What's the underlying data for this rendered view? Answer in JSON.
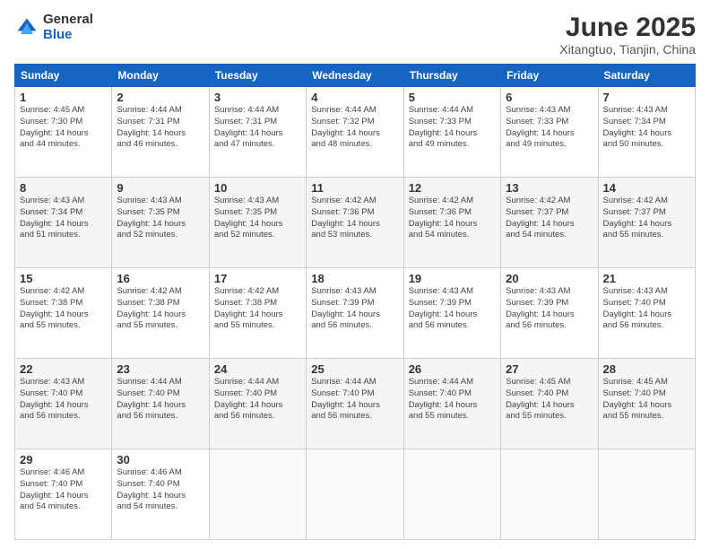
{
  "logo": {
    "general": "General",
    "blue": "Blue"
  },
  "title": "June 2025",
  "subtitle": "Xitangtuo, Tianjin, China",
  "headers": [
    "Sunday",
    "Monday",
    "Tuesday",
    "Wednesday",
    "Thursday",
    "Friday",
    "Saturday"
  ],
  "weeks": [
    [
      {
        "day": "1",
        "lines": [
          "Sunrise: 4:45 AM",
          "Sunset: 7:30 PM",
          "Daylight: 14 hours",
          "and 44 minutes."
        ]
      },
      {
        "day": "2",
        "lines": [
          "Sunrise: 4:44 AM",
          "Sunset: 7:31 PM",
          "Daylight: 14 hours",
          "and 46 minutes."
        ]
      },
      {
        "day": "3",
        "lines": [
          "Sunrise: 4:44 AM",
          "Sunset: 7:31 PM",
          "Daylight: 14 hours",
          "and 47 minutes."
        ]
      },
      {
        "day": "4",
        "lines": [
          "Sunrise: 4:44 AM",
          "Sunset: 7:32 PM",
          "Daylight: 14 hours",
          "and 48 minutes."
        ]
      },
      {
        "day": "5",
        "lines": [
          "Sunrise: 4:44 AM",
          "Sunset: 7:33 PM",
          "Daylight: 14 hours",
          "and 49 minutes."
        ]
      },
      {
        "day": "6",
        "lines": [
          "Sunrise: 4:43 AM",
          "Sunset: 7:33 PM",
          "Daylight: 14 hours",
          "and 49 minutes."
        ]
      },
      {
        "day": "7",
        "lines": [
          "Sunrise: 4:43 AM",
          "Sunset: 7:34 PM",
          "Daylight: 14 hours",
          "and 50 minutes."
        ]
      }
    ],
    [
      {
        "day": "8",
        "lines": [
          "Sunrise: 4:43 AM",
          "Sunset: 7:34 PM",
          "Daylight: 14 hours",
          "and 51 minutes."
        ]
      },
      {
        "day": "9",
        "lines": [
          "Sunrise: 4:43 AM",
          "Sunset: 7:35 PM",
          "Daylight: 14 hours",
          "and 52 minutes."
        ]
      },
      {
        "day": "10",
        "lines": [
          "Sunrise: 4:43 AM",
          "Sunset: 7:35 PM",
          "Daylight: 14 hours",
          "and 52 minutes."
        ]
      },
      {
        "day": "11",
        "lines": [
          "Sunrise: 4:42 AM",
          "Sunset: 7:36 PM",
          "Daylight: 14 hours",
          "and 53 minutes."
        ]
      },
      {
        "day": "12",
        "lines": [
          "Sunrise: 4:42 AM",
          "Sunset: 7:36 PM",
          "Daylight: 14 hours",
          "and 54 minutes."
        ]
      },
      {
        "day": "13",
        "lines": [
          "Sunrise: 4:42 AM",
          "Sunset: 7:37 PM",
          "Daylight: 14 hours",
          "and 54 minutes."
        ]
      },
      {
        "day": "14",
        "lines": [
          "Sunrise: 4:42 AM",
          "Sunset: 7:37 PM",
          "Daylight: 14 hours",
          "and 55 minutes."
        ]
      }
    ],
    [
      {
        "day": "15",
        "lines": [
          "Sunrise: 4:42 AM",
          "Sunset: 7:38 PM",
          "Daylight: 14 hours",
          "and 55 minutes."
        ]
      },
      {
        "day": "16",
        "lines": [
          "Sunrise: 4:42 AM",
          "Sunset: 7:38 PM",
          "Daylight: 14 hours",
          "and 55 minutes."
        ]
      },
      {
        "day": "17",
        "lines": [
          "Sunrise: 4:42 AM",
          "Sunset: 7:38 PM",
          "Daylight: 14 hours",
          "and 55 minutes."
        ]
      },
      {
        "day": "18",
        "lines": [
          "Sunrise: 4:43 AM",
          "Sunset: 7:39 PM",
          "Daylight: 14 hours",
          "and 56 minutes."
        ]
      },
      {
        "day": "19",
        "lines": [
          "Sunrise: 4:43 AM",
          "Sunset: 7:39 PM",
          "Daylight: 14 hours",
          "and 56 minutes."
        ]
      },
      {
        "day": "20",
        "lines": [
          "Sunrise: 4:43 AM",
          "Sunset: 7:39 PM",
          "Daylight: 14 hours",
          "and 56 minutes."
        ]
      },
      {
        "day": "21",
        "lines": [
          "Sunrise: 4:43 AM",
          "Sunset: 7:40 PM",
          "Daylight: 14 hours",
          "and 56 minutes."
        ]
      }
    ],
    [
      {
        "day": "22",
        "lines": [
          "Sunrise: 4:43 AM",
          "Sunset: 7:40 PM",
          "Daylight: 14 hours",
          "and 56 minutes."
        ]
      },
      {
        "day": "23",
        "lines": [
          "Sunrise: 4:44 AM",
          "Sunset: 7:40 PM",
          "Daylight: 14 hours",
          "and 56 minutes."
        ]
      },
      {
        "day": "24",
        "lines": [
          "Sunrise: 4:44 AM",
          "Sunset: 7:40 PM",
          "Daylight: 14 hours",
          "and 56 minutes."
        ]
      },
      {
        "day": "25",
        "lines": [
          "Sunrise: 4:44 AM",
          "Sunset: 7:40 PM",
          "Daylight: 14 hours",
          "and 56 minutes."
        ]
      },
      {
        "day": "26",
        "lines": [
          "Sunrise: 4:44 AM",
          "Sunset: 7:40 PM",
          "Daylight: 14 hours",
          "and 55 minutes."
        ]
      },
      {
        "day": "27",
        "lines": [
          "Sunrise: 4:45 AM",
          "Sunset: 7:40 PM",
          "Daylight: 14 hours",
          "and 55 minutes."
        ]
      },
      {
        "day": "28",
        "lines": [
          "Sunrise: 4:45 AM",
          "Sunset: 7:40 PM",
          "Daylight: 14 hours",
          "and 55 minutes."
        ]
      }
    ],
    [
      {
        "day": "29",
        "lines": [
          "Sunrise: 4:46 AM",
          "Sunset: 7:40 PM",
          "Daylight: 14 hours",
          "and 54 minutes."
        ]
      },
      {
        "day": "30",
        "lines": [
          "Sunrise: 4:46 AM",
          "Sunset: 7:40 PM",
          "Daylight: 14 hours",
          "and 54 minutes."
        ]
      },
      {
        "day": "",
        "lines": []
      },
      {
        "day": "",
        "lines": []
      },
      {
        "day": "",
        "lines": []
      },
      {
        "day": "",
        "lines": []
      },
      {
        "day": "",
        "lines": []
      }
    ]
  ]
}
